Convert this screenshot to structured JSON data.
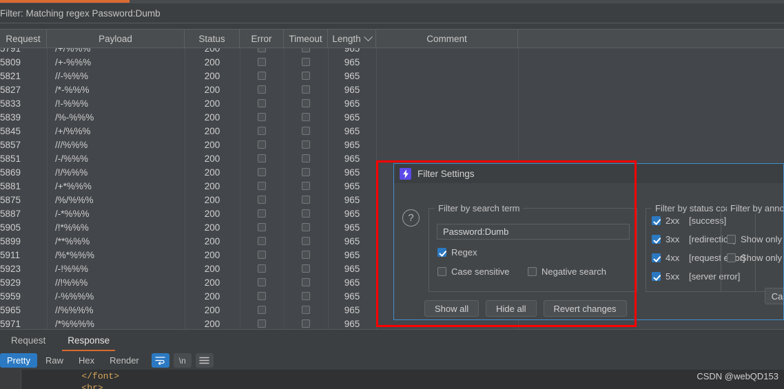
{
  "window": {
    "filter_status": "Filter: Matching regex Password:Dumb",
    "watermark": "CSDN @webQD153"
  },
  "table": {
    "columns": [
      {
        "label": "Request",
        "key": "request"
      },
      {
        "label": "Payload",
        "key": "payload"
      },
      {
        "label": "Status",
        "key": "status"
      },
      {
        "label": "Error",
        "key": "error"
      },
      {
        "label": "Timeout",
        "key": "timeout"
      },
      {
        "label": "Length",
        "key": "length",
        "sorted": true
      },
      {
        "label": "Comment",
        "key": "comment"
      }
    ],
    "rows": [
      {
        "request": "5791",
        "payload": "/+/%%%",
        "status": "200",
        "error": false,
        "timeout": false,
        "length": "965",
        "comment": ""
      },
      {
        "request": "5809",
        "payload": "/+-%%%",
        "status": "200",
        "error": false,
        "timeout": false,
        "length": "965",
        "comment": ""
      },
      {
        "request": "5821",
        "payload": "//-%%%",
        "status": "200",
        "error": false,
        "timeout": false,
        "length": "965",
        "comment": ""
      },
      {
        "request": "5827",
        "payload": "/*-%%%",
        "status": "200",
        "error": false,
        "timeout": false,
        "length": "965",
        "comment": ""
      },
      {
        "request": "5833",
        "payload": "/!-%%%",
        "status": "200",
        "error": false,
        "timeout": false,
        "length": "965",
        "comment": ""
      },
      {
        "request": "5839",
        "payload": "/%-%%%",
        "status": "200",
        "error": false,
        "timeout": false,
        "length": "965",
        "comment": ""
      },
      {
        "request": "5845",
        "payload": "/+/%%%",
        "status": "200",
        "error": false,
        "timeout": false,
        "length": "965",
        "comment": ""
      },
      {
        "request": "5857",
        "payload": "///%%%",
        "status": "200",
        "error": false,
        "timeout": false,
        "length": "965",
        "comment": ""
      },
      {
        "request": "5851",
        "payload": "/-/%%%",
        "status": "200",
        "error": false,
        "timeout": false,
        "length": "965",
        "comment": ""
      },
      {
        "request": "5869",
        "payload": "/!/%%%",
        "status": "200",
        "error": false,
        "timeout": false,
        "length": "965",
        "comment": ""
      },
      {
        "request": "5881",
        "payload": "/+*%%%",
        "status": "200",
        "error": false,
        "timeout": false,
        "length": "965",
        "comment": ""
      },
      {
        "request": "5875",
        "payload": "/%/%%%",
        "status": "200",
        "error": false,
        "timeout": false,
        "length": "965",
        "comment": ""
      },
      {
        "request": "5887",
        "payload": "/-*%%%",
        "status": "200",
        "error": false,
        "timeout": false,
        "length": "965",
        "comment": ""
      },
      {
        "request": "5905",
        "payload": "/!*%%%",
        "status": "200",
        "error": false,
        "timeout": false,
        "length": "965",
        "comment": ""
      },
      {
        "request": "5899",
        "payload": "/**%%%",
        "status": "200",
        "error": false,
        "timeout": false,
        "length": "965",
        "comment": ""
      },
      {
        "request": "5911",
        "payload": "/%*%%%",
        "status": "200",
        "error": false,
        "timeout": false,
        "length": "965",
        "comment": ""
      },
      {
        "request": "5923",
        "payload": "/-!%%%",
        "status": "200",
        "error": false,
        "timeout": false,
        "length": "965",
        "comment": ""
      },
      {
        "request": "5929",
        "payload": "//!%%%",
        "status": "200",
        "error": false,
        "timeout": false,
        "length": "965",
        "comment": ""
      },
      {
        "request": "5959",
        "payload": "/-%%%%",
        "status": "200",
        "error": false,
        "timeout": false,
        "length": "965",
        "comment": ""
      },
      {
        "request": "5965",
        "payload": "//%%%%",
        "status": "200",
        "error": false,
        "timeout": false,
        "length": "965",
        "comment": ""
      },
      {
        "request": "5971",
        "payload": "/*%%%%",
        "status": "200",
        "error": false,
        "timeout": false,
        "length": "965",
        "comment": ""
      }
    ]
  },
  "dialog": {
    "title": "Filter Settings",
    "icon": "lightning-bolt-icon",
    "help_icon": "question-mark-icon",
    "search_group": {
      "legend": "Filter by search term",
      "value": "Password:Dumb",
      "placeholder": "",
      "options": [
        {
          "label": "Regex",
          "checked": true
        },
        {
          "label": "Case sensitive",
          "checked": false
        },
        {
          "label": "Negative search",
          "checked": false
        }
      ]
    },
    "status_group": {
      "legend": "Filter by status code",
      "options": [
        {
          "code": "2xx",
          "label": "[success]",
          "checked": true
        },
        {
          "code": "3xx",
          "label": "[redirection]",
          "checked": true
        },
        {
          "code": "4xx",
          "label": "[request error]",
          "checked": true
        },
        {
          "code": "5xx",
          "label": "[server error]",
          "checked": true
        }
      ]
    },
    "annotation_group": {
      "legend": "Filter by annotation",
      "options": [
        {
          "label": "Show only c",
          "checked": false
        },
        {
          "label": "Show only h",
          "checked": false
        }
      ]
    },
    "buttons": {
      "show_all": "Show all",
      "hide_all": "Hide all",
      "revert": "Revert changes",
      "cancel": "Cancel"
    }
  },
  "bottom": {
    "tabs": [
      {
        "label": "Request",
        "active": false
      },
      {
        "label": "Response",
        "active": true
      }
    ],
    "viewer_modes": [
      {
        "label": "Pretty",
        "active": true
      },
      {
        "label": "Raw",
        "active": false
      },
      {
        "label": "Hex",
        "active": false
      },
      {
        "label": "Render",
        "active": false
      }
    ],
    "viewer_icons": [
      {
        "name": "word-wrap-icon",
        "glyph": "↵",
        "active": true
      },
      {
        "name": "newline-icon",
        "glyph": "\\n",
        "active": false
      },
      {
        "name": "menu-icon",
        "glyph": "≡",
        "active": false
      }
    ],
    "code_lines": [
      "        </font>",
      "        <br>"
    ]
  }
}
